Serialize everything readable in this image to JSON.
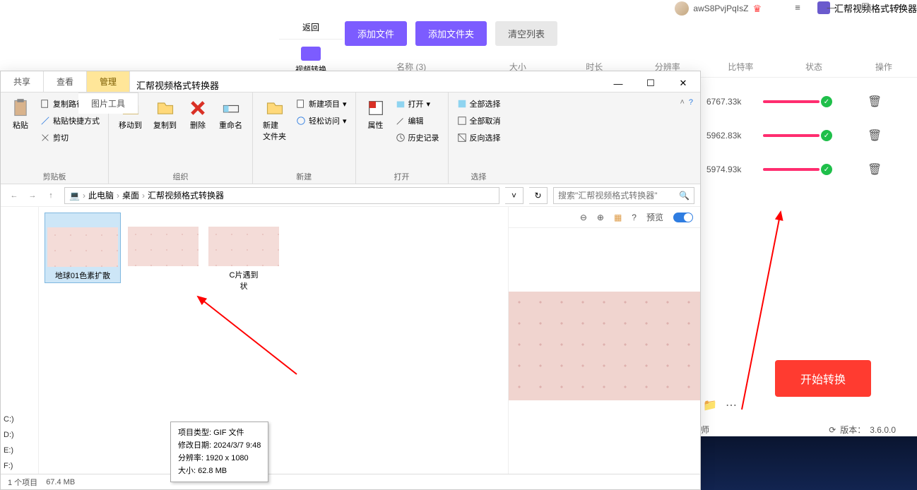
{
  "bg_app": {
    "title": "汇帮视频格式转换器",
    "user": "awS8PvjPqIsZ",
    "back": "返回",
    "nav_label": "视频转换",
    "buttons": {
      "add_file": "添加文件",
      "add_folder": "添加文件夹",
      "clear_list": "清空列表"
    },
    "columns": {
      "name": "名称 (3)",
      "size": "大小",
      "duration": "时长",
      "resolution": "分辨率",
      "bitrate": "比特率",
      "status": "状态",
      "operation": "操作"
    },
    "rows": [
      {
        "bitrate": "6767.33k"
      },
      {
        "bitrate": "5962.83k"
      },
      {
        "bitrate": "5974.93k"
      }
    ],
    "start": "开始转换",
    "shi": "师",
    "version_prefix": "版本：",
    "version": "3.6.0.0"
  },
  "explorer": {
    "tabs": {
      "share": "共享",
      "view": "查看",
      "manage": "管理",
      "picture_tools": "图片工具"
    },
    "title": "汇帮视频格式转换器",
    "ribbon": {
      "clipboard": {
        "paste": "粘贴",
        "copy_path": "复制路径",
        "paste_shortcut": "粘贴快捷方式",
        "cut": "剪切",
        "label": "剪贴板"
      },
      "organize": {
        "move_to": "移动到",
        "copy_to": "复制到",
        "delete": "删除",
        "rename": "重命名",
        "label": "组织"
      },
      "new": {
        "new_folder": "新建\n文件夹",
        "new_item": "新建项目",
        "easy_access": "轻松访问",
        "label": "新建"
      },
      "open": {
        "properties": "属性",
        "open": "打开",
        "edit": "编辑",
        "history": "历史记录",
        "label": "打开"
      },
      "select": {
        "select_all": "全部选择",
        "select_none": "全部取消",
        "invert": "反向选择",
        "label": "选择"
      }
    },
    "breadcrumbs": [
      "此电脑",
      "桌面",
      "汇帮视频格式转换器"
    ],
    "search_placeholder": "搜索\"汇帮视频格式转换器\"",
    "drives": [
      "C:)",
      "D:)",
      "E:)",
      "F:)"
    ],
    "files": [
      {
        "name": "地球01色素扩散"
      },
      {
        "name": ""
      },
      {
        "name_suffix": "C片遇到",
        "name_suffix2": "状"
      }
    ],
    "tooltip": {
      "line1": "项目类型: GIF 文件",
      "line2": "修改日期: 2024/3/7 9:48",
      "line3": "分辨率: 1920 x 1080",
      "line4": "大小: 62.8 MB"
    },
    "preview_label": "预览",
    "status": {
      "items": "1 个项目",
      "size": "67.4 MB"
    }
  }
}
